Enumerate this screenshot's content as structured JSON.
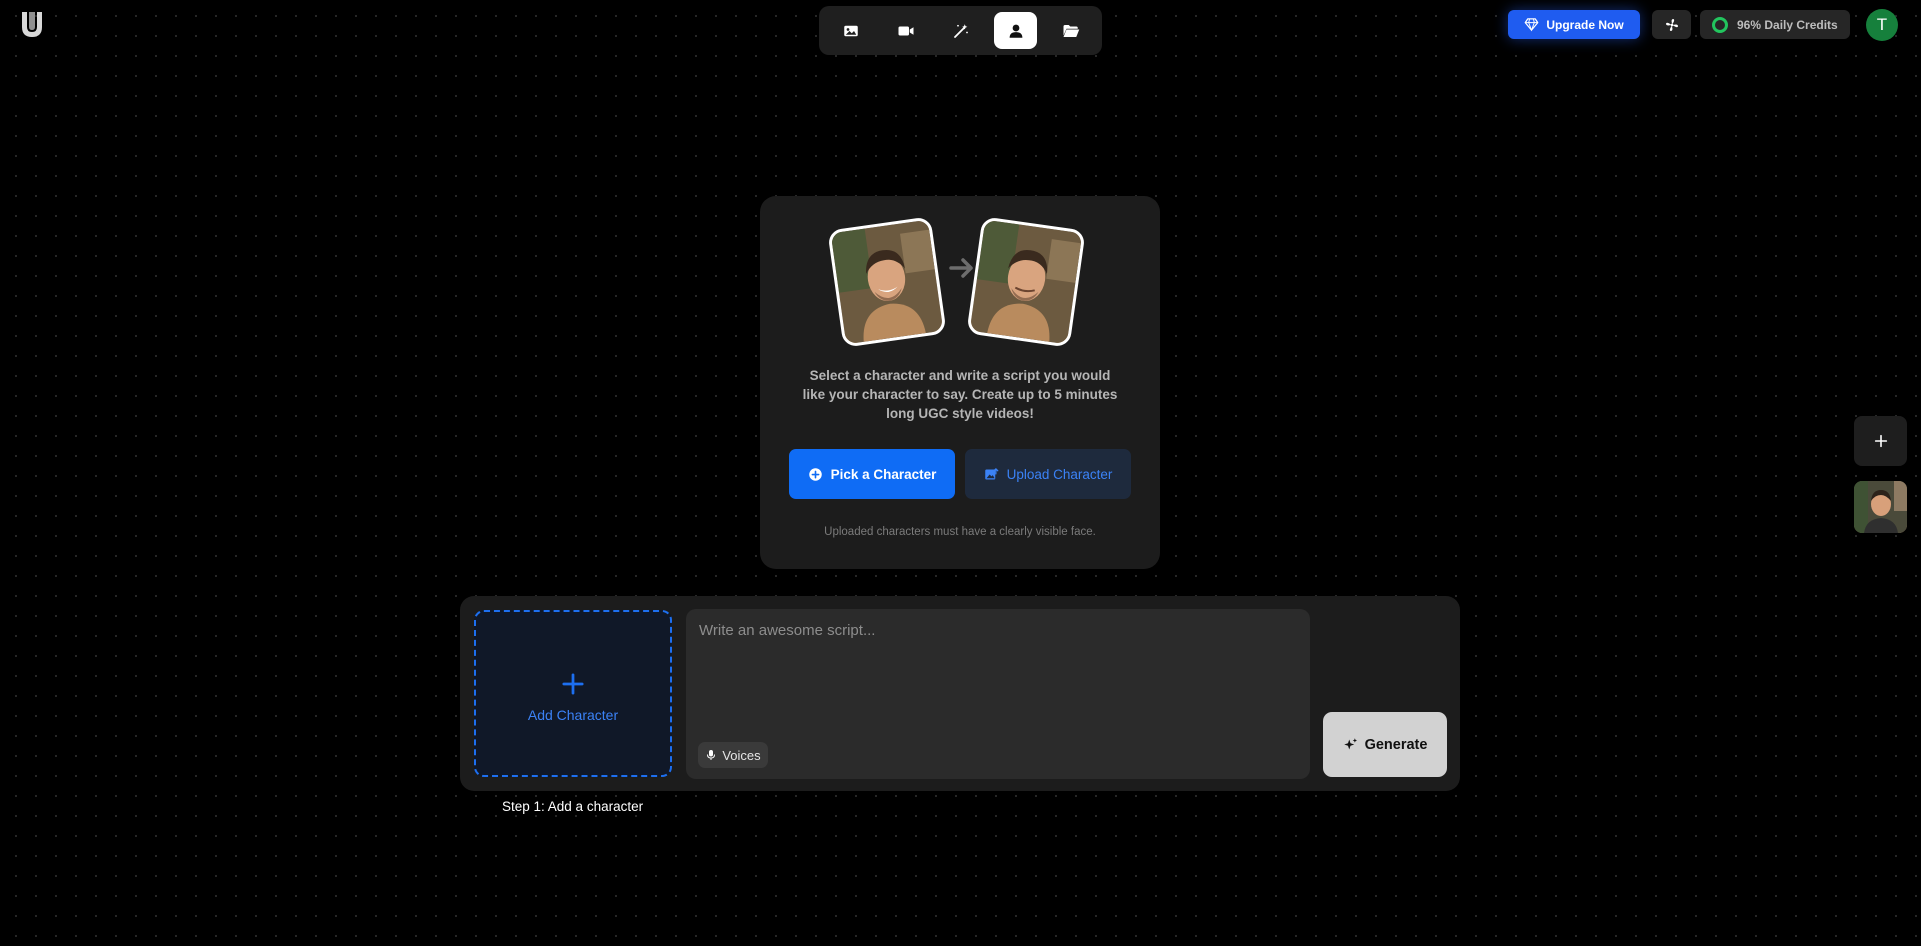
{
  "header": {
    "logo_icon": "u-logo-icon",
    "nav_items": [
      {
        "name": "image",
        "icon": "image-icon",
        "active": false
      },
      {
        "name": "video",
        "icon": "video-camera-icon",
        "active": false
      },
      {
        "name": "edit",
        "icon": "magic-wand-icon",
        "active": false
      },
      {
        "name": "character",
        "icon": "user-icon",
        "active": true
      },
      {
        "name": "files",
        "icon": "folder-open-icon",
        "active": false
      }
    ],
    "upgrade_label": "Upgrade Now",
    "credits_label": "96% Daily Credits",
    "avatar_letter": "T"
  },
  "intro": {
    "description": "Select a character and write a script you would like your character to say. Create up to 5 minutes long UGC style videos!",
    "pick_label": "Pick a Character",
    "upload_label": "Upload Character",
    "note": "Uploaded characters must have a clearly visible face."
  },
  "composer": {
    "add_character_label": "Add Character",
    "script_placeholder": "Write an awesome script...",
    "voices_label": "Voices",
    "generate_label": "Generate",
    "step_label": "Step 1: Add a character"
  },
  "colors": {
    "accent": "#0f6cf5",
    "upgrade": "#1f5cf0",
    "credits_ring": "#22c55e",
    "avatar": "#16803c"
  }
}
